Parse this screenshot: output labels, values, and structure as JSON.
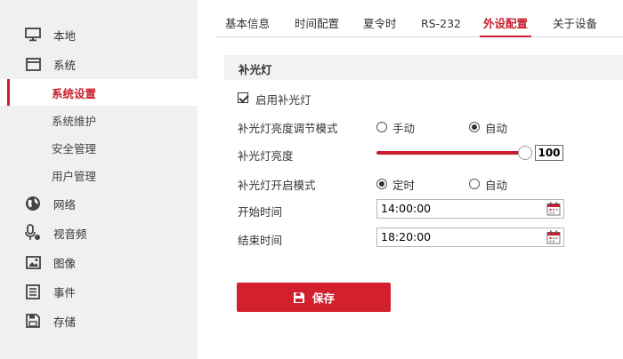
{
  "sidebar": {
    "items": [
      {
        "label": "本地",
        "icon": "monitor-icon"
      },
      {
        "label": "系统",
        "icon": "window-icon"
      },
      {
        "label": "网络",
        "icon": "globe-icon"
      },
      {
        "label": "视音频",
        "icon": "microphone-icon"
      },
      {
        "label": "图像",
        "icon": "image-icon"
      },
      {
        "label": "事件",
        "icon": "list-icon"
      },
      {
        "label": "存储",
        "icon": "floppy-icon"
      }
    ],
    "sub_items": [
      {
        "label": "系统设置",
        "active": true
      },
      {
        "label": "系统维护",
        "active": false
      },
      {
        "label": "安全管理",
        "active": false
      },
      {
        "label": "用户管理",
        "active": false
      }
    ]
  },
  "tabs": [
    {
      "label": "基本信息"
    },
    {
      "label": "时间配置"
    },
    {
      "label": "夏令时"
    },
    {
      "label": "RS-232"
    },
    {
      "label": "外设配置",
      "active": true
    },
    {
      "label": "关于设备"
    }
  ],
  "section": {
    "title": "补光灯",
    "enable_label": "启用补光灯",
    "enable_checked": true,
    "brightness_mode_label": "补光灯亮度调节模式",
    "brightness_mode_options": [
      "手动",
      "自动"
    ],
    "brightness_mode_selected": "自动",
    "brightness_label": "补光灯亮度",
    "brightness_value": "100",
    "open_mode_label": "补光灯开启模式",
    "open_mode_options": [
      "定时",
      "自动"
    ],
    "open_mode_selected": "定时",
    "start_label": "开始时间",
    "start_value": "14:00:00",
    "end_label": "结束时间",
    "end_value": "18:20:00"
  },
  "save_label": "保存",
  "colors": {
    "accent": "#c81e2e",
    "sidebar_bg": "#f0f0f0",
    "button_bg": "#d2202f"
  }
}
